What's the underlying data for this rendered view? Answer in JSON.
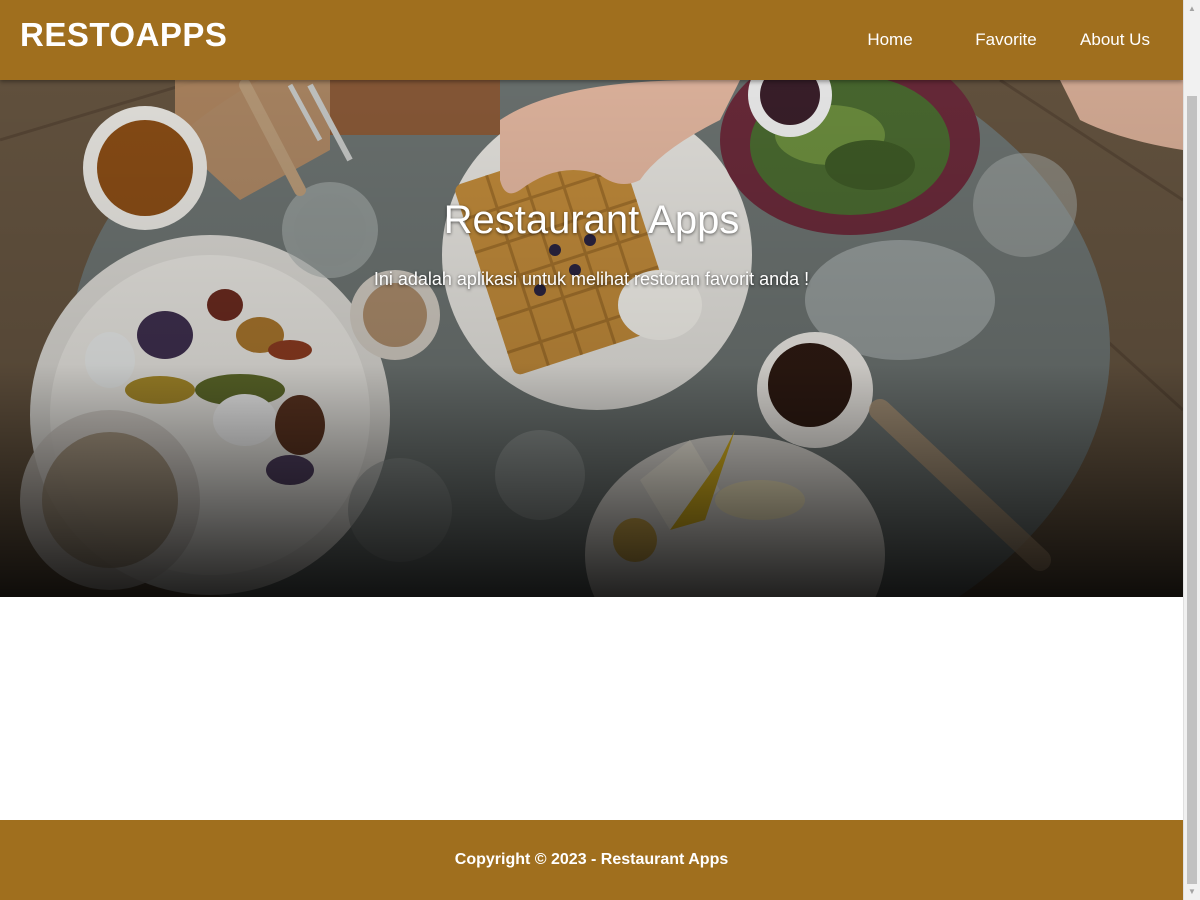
{
  "app_bar": {
    "brand": "RESTOAPPS",
    "nav": [
      {
        "label": "Home"
      },
      {
        "label": "Favorite"
      },
      {
        "label": "About Us"
      }
    ]
  },
  "hero": {
    "title": "Restaurant Apps",
    "subtitle": "Ini adalah aplikasi untuk melihat restoran favorit anda !"
  },
  "footer": {
    "text": "Copyright © 2023 - Restaurant Apps"
  },
  "colors": {
    "brand": "#a06f1e",
    "text_on_brand": "#ffffff"
  },
  "icons": {
    "scroll_up": "triangle-up",
    "scroll_down": "triangle-down"
  }
}
